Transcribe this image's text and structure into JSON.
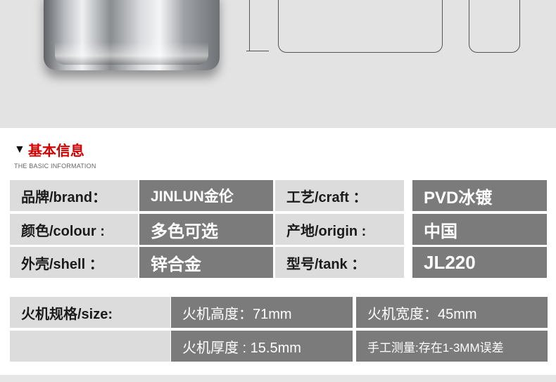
{
  "basic_info": {
    "title": "基本信息",
    "subtitle": "THE BASIC INFORMATION",
    "rows": [
      [
        {
          "label": "品牌/brand：",
          "value": "JINLUN金伦"
        },
        {
          "label": "工艺/craft ：",
          "value": "PVD冰镀"
        }
      ],
      [
        {
          "label": "颜色/colour :",
          "value": "多色可选"
        },
        {
          "label": "产地/origin :",
          "value": "中国"
        }
      ],
      [
        {
          "label": "外壳/shell ：",
          "value": "锌合金"
        },
        {
          "label": "型号/tank ：",
          "value": "JL220"
        }
      ]
    ]
  },
  "size_table": {
    "label": "火机规格/size:",
    "height": "火机高度：71mm",
    "width": "火机宽度：45mm",
    "thickness": "火机厚度 : 15.5mm",
    "note": "手工测量:存在1-3MM误差"
  }
}
